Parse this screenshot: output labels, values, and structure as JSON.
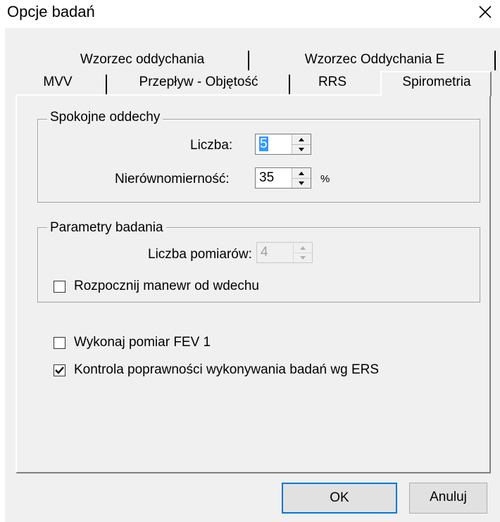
{
  "window": {
    "title": "Opcje badań"
  },
  "tabs": {
    "row_back": [
      "Wzorzec oddychania",
      "Wzorzec Oddychania E"
    ],
    "row_front": [
      "MVV",
      "Przepływ - Objętość",
      "RRS",
      "Spirometria"
    ],
    "active": "Spirometria"
  },
  "group_quiet": {
    "legend": "Spokojne oddechy",
    "count_label": "Liczba:",
    "count_value": "5",
    "unevenness_label": "Nierównomierność:",
    "unevenness_value": "35",
    "unevenness_unit": "%"
  },
  "group_params": {
    "legend": "Parametry badania",
    "measurements_label": "Liczba pomiarów:",
    "measurements_value": "4",
    "start_inhale_label": "Rozpocznij manewr od wdechu",
    "start_inhale_checked": false
  },
  "options": {
    "fev1_label": "Wykonaj pomiar FEV 1",
    "fev1_checked": false,
    "ers_label": "Kontrola poprawności wykonywania badań wg ERS",
    "ers_checked": true
  },
  "buttons": {
    "ok": "OK",
    "cancel": "Anuluj"
  }
}
